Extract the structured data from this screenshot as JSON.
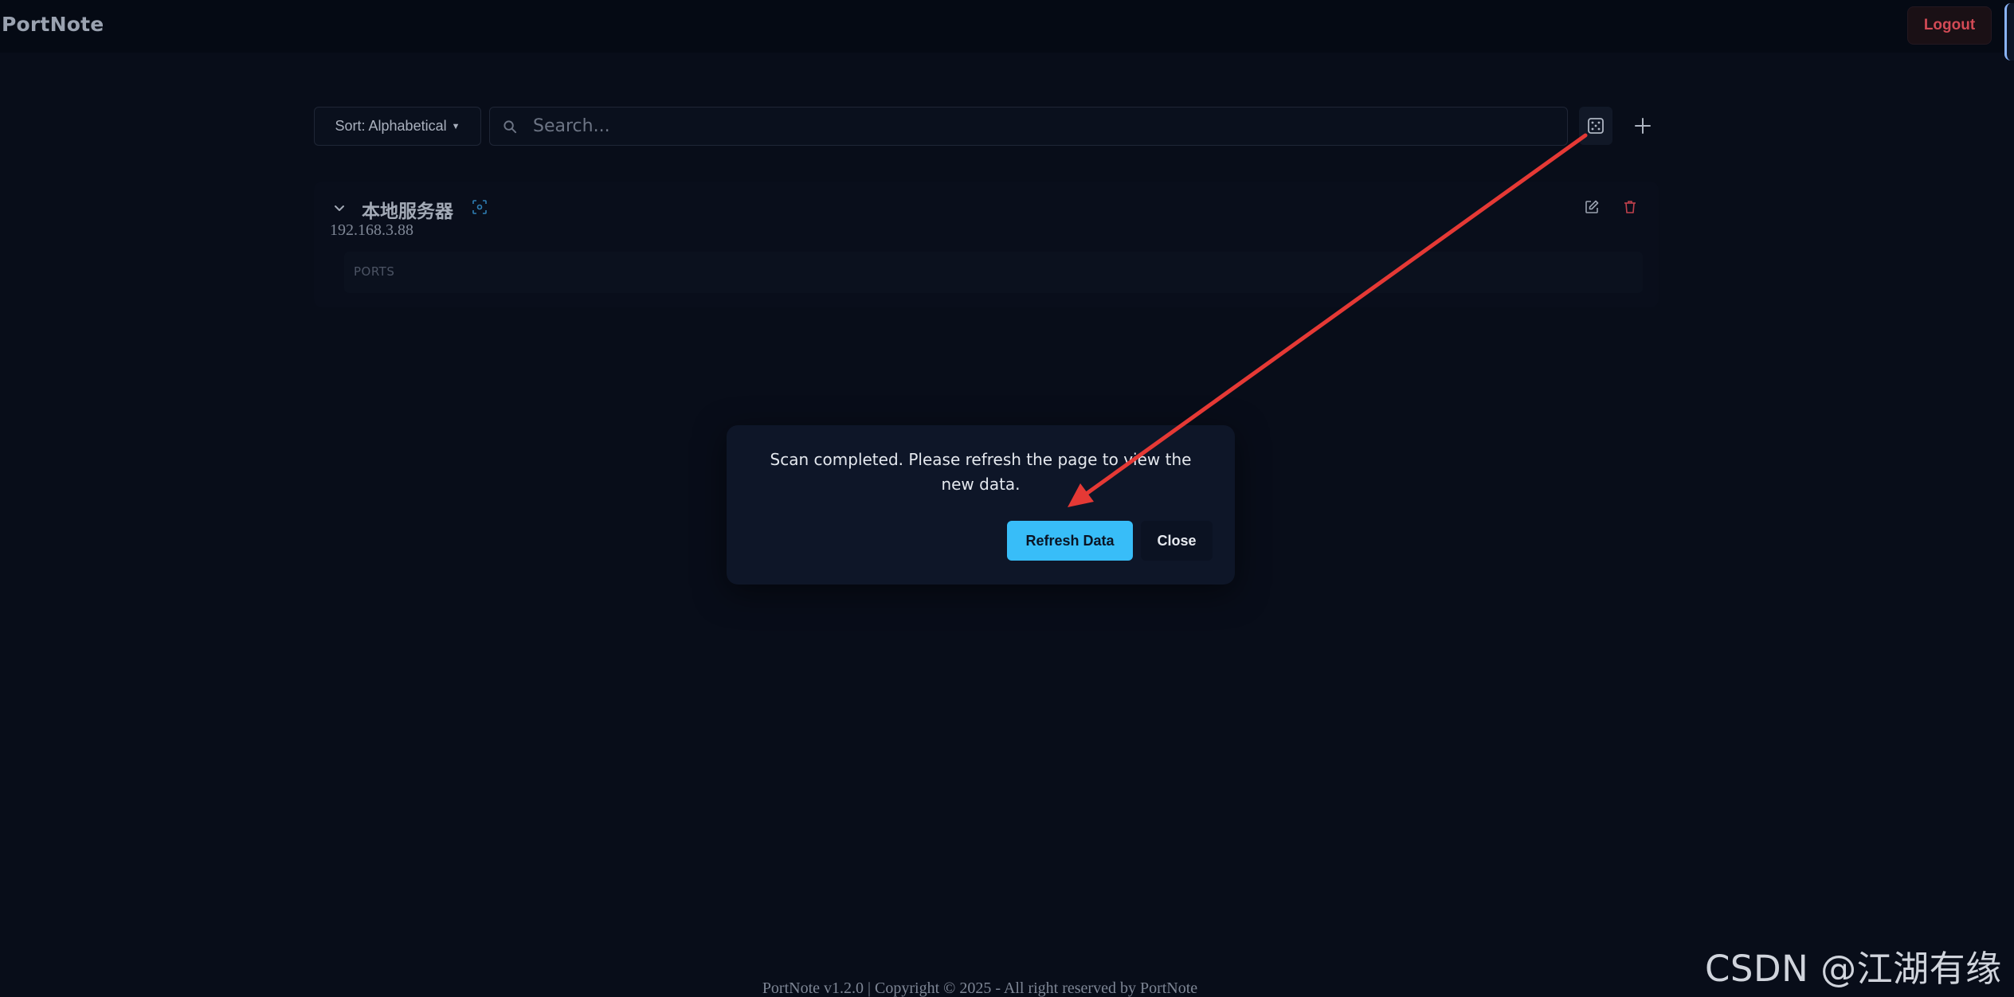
{
  "header": {
    "brand": "PortNote",
    "logout_label": "Logout"
  },
  "toolbar": {
    "sort_label": "Sort: Alphabetical",
    "search_placeholder": "Search...",
    "scan_icon": "dice-scan-icon",
    "add_icon": "plus-icon"
  },
  "server": {
    "name": "本地服务器",
    "ip": "192.168.3.88",
    "ports_label": "PORTS"
  },
  "modal": {
    "message": "Scan completed. Please refresh the page to view the new data.",
    "refresh_label": "Refresh Data",
    "close_label": "Close"
  },
  "footer": {
    "text": "PortNote v1.2.0 | Copyright © 2025 - All right reserved by PortNote"
  },
  "watermark": "CSDN @江湖有缘",
  "colors": {
    "background": "#080d19",
    "accent": "#38bdf8",
    "danger": "#d24a55",
    "annotation_arrow": "#e53935"
  }
}
